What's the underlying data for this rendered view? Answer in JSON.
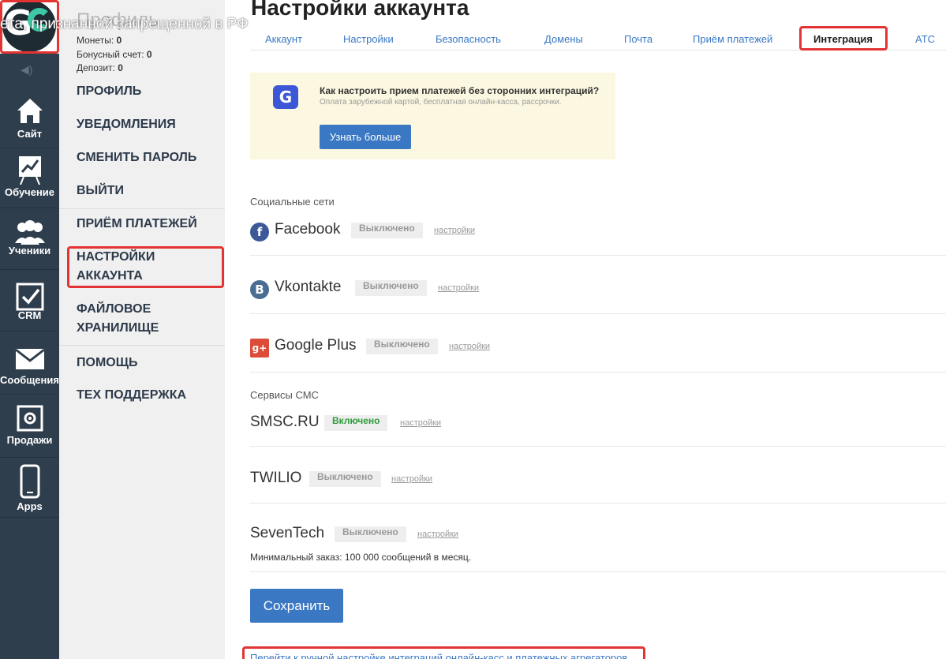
{
  "overlay": {
    "text": "ета, признанной запрещенной в РФ"
  },
  "rail": {
    "items": [
      {
        "label": "Сайт",
        "icon": "home-icon"
      },
      {
        "label": "Обучение",
        "icon": "chart-board-icon"
      },
      {
        "label": "Ученики",
        "icon": "users-icon"
      },
      {
        "label": "CRM",
        "icon": "checkbox-icon"
      },
      {
        "label": "Сообщения",
        "icon": "envelope-icon"
      },
      {
        "label": "Продажи",
        "icon": "register-icon"
      },
      {
        "label": "Apps",
        "icon": "phone-icon"
      }
    ]
  },
  "menu": {
    "title": "Профиль",
    "coins_label": "Монеты:",
    "coins_value": "0",
    "bonus_label": "Бонусный счет:",
    "bonus_value": "0",
    "deposit_label": "Депозит:",
    "deposit_value": "0",
    "items": [
      "ПРОФИЛЬ",
      "УВЕДОМЛЕНИЯ",
      "СМЕНИТЬ ПАРОЛЬ",
      "ВЫЙТИ",
      "ПРИЁМ ПЛАТЕЖЕЙ",
      "НАСТРОЙКИ АККАУНТА",
      "ФАЙЛОВОЕ ХРАНИЛИЩЕ",
      "ПОМОЩЬ",
      "ТЕХ ПОДДЕРЖКА"
    ]
  },
  "main": {
    "title": "Настройки аккаунта",
    "tabs": [
      "Аккаунт",
      "Настройки",
      "Безопасность",
      "Домены",
      "Почта",
      "Приём платежей",
      "Интеграция",
      "АТС"
    ],
    "active_tab": "Интеграция",
    "promo": {
      "title": "Как настроить прием платежей без сторонних интеграций?",
      "subtitle": "Оплата зарубежной картой, бесплатная онлайн-касса, рассрочки.",
      "button": "Узнать больше"
    },
    "social_label": "Социальные сети",
    "sms_label": "Сервисы СМС",
    "settings_link": "настройки",
    "integrations": [
      {
        "name": "Facebook",
        "status": "Выключено",
        "icon": "facebook-icon",
        "color": "#3b5998"
      },
      {
        "name": "Vkontakte",
        "status": "Выключено",
        "icon": "vk-icon",
        "color": "#4a6d93"
      },
      {
        "name": "Google Plus",
        "status": "Выключено",
        "icon": "google-plus-icon",
        "color": "#dd4b39"
      },
      {
        "name": "SMSC.RU",
        "status": "Включено"
      },
      {
        "name": "TWILIO",
        "status": "Выключено"
      },
      {
        "name": "SevenTech",
        "status": "Выключено"
      }
    ],
    "min_order": "Минимальный заказ: 100 000 сообщений в месяц.",
    "save_button": "Сохранить",
    "bottom_link": "Перейти к ручной настройке интеграций онлайн-касс и платежных агрегаторов"
  },
  "colors": {
    "accent": "#3a78c4",
    "rail": "#2f3e4d",
    "highlight": "#e33434",
    "enabled": "#2e9a3b"
  }
}
